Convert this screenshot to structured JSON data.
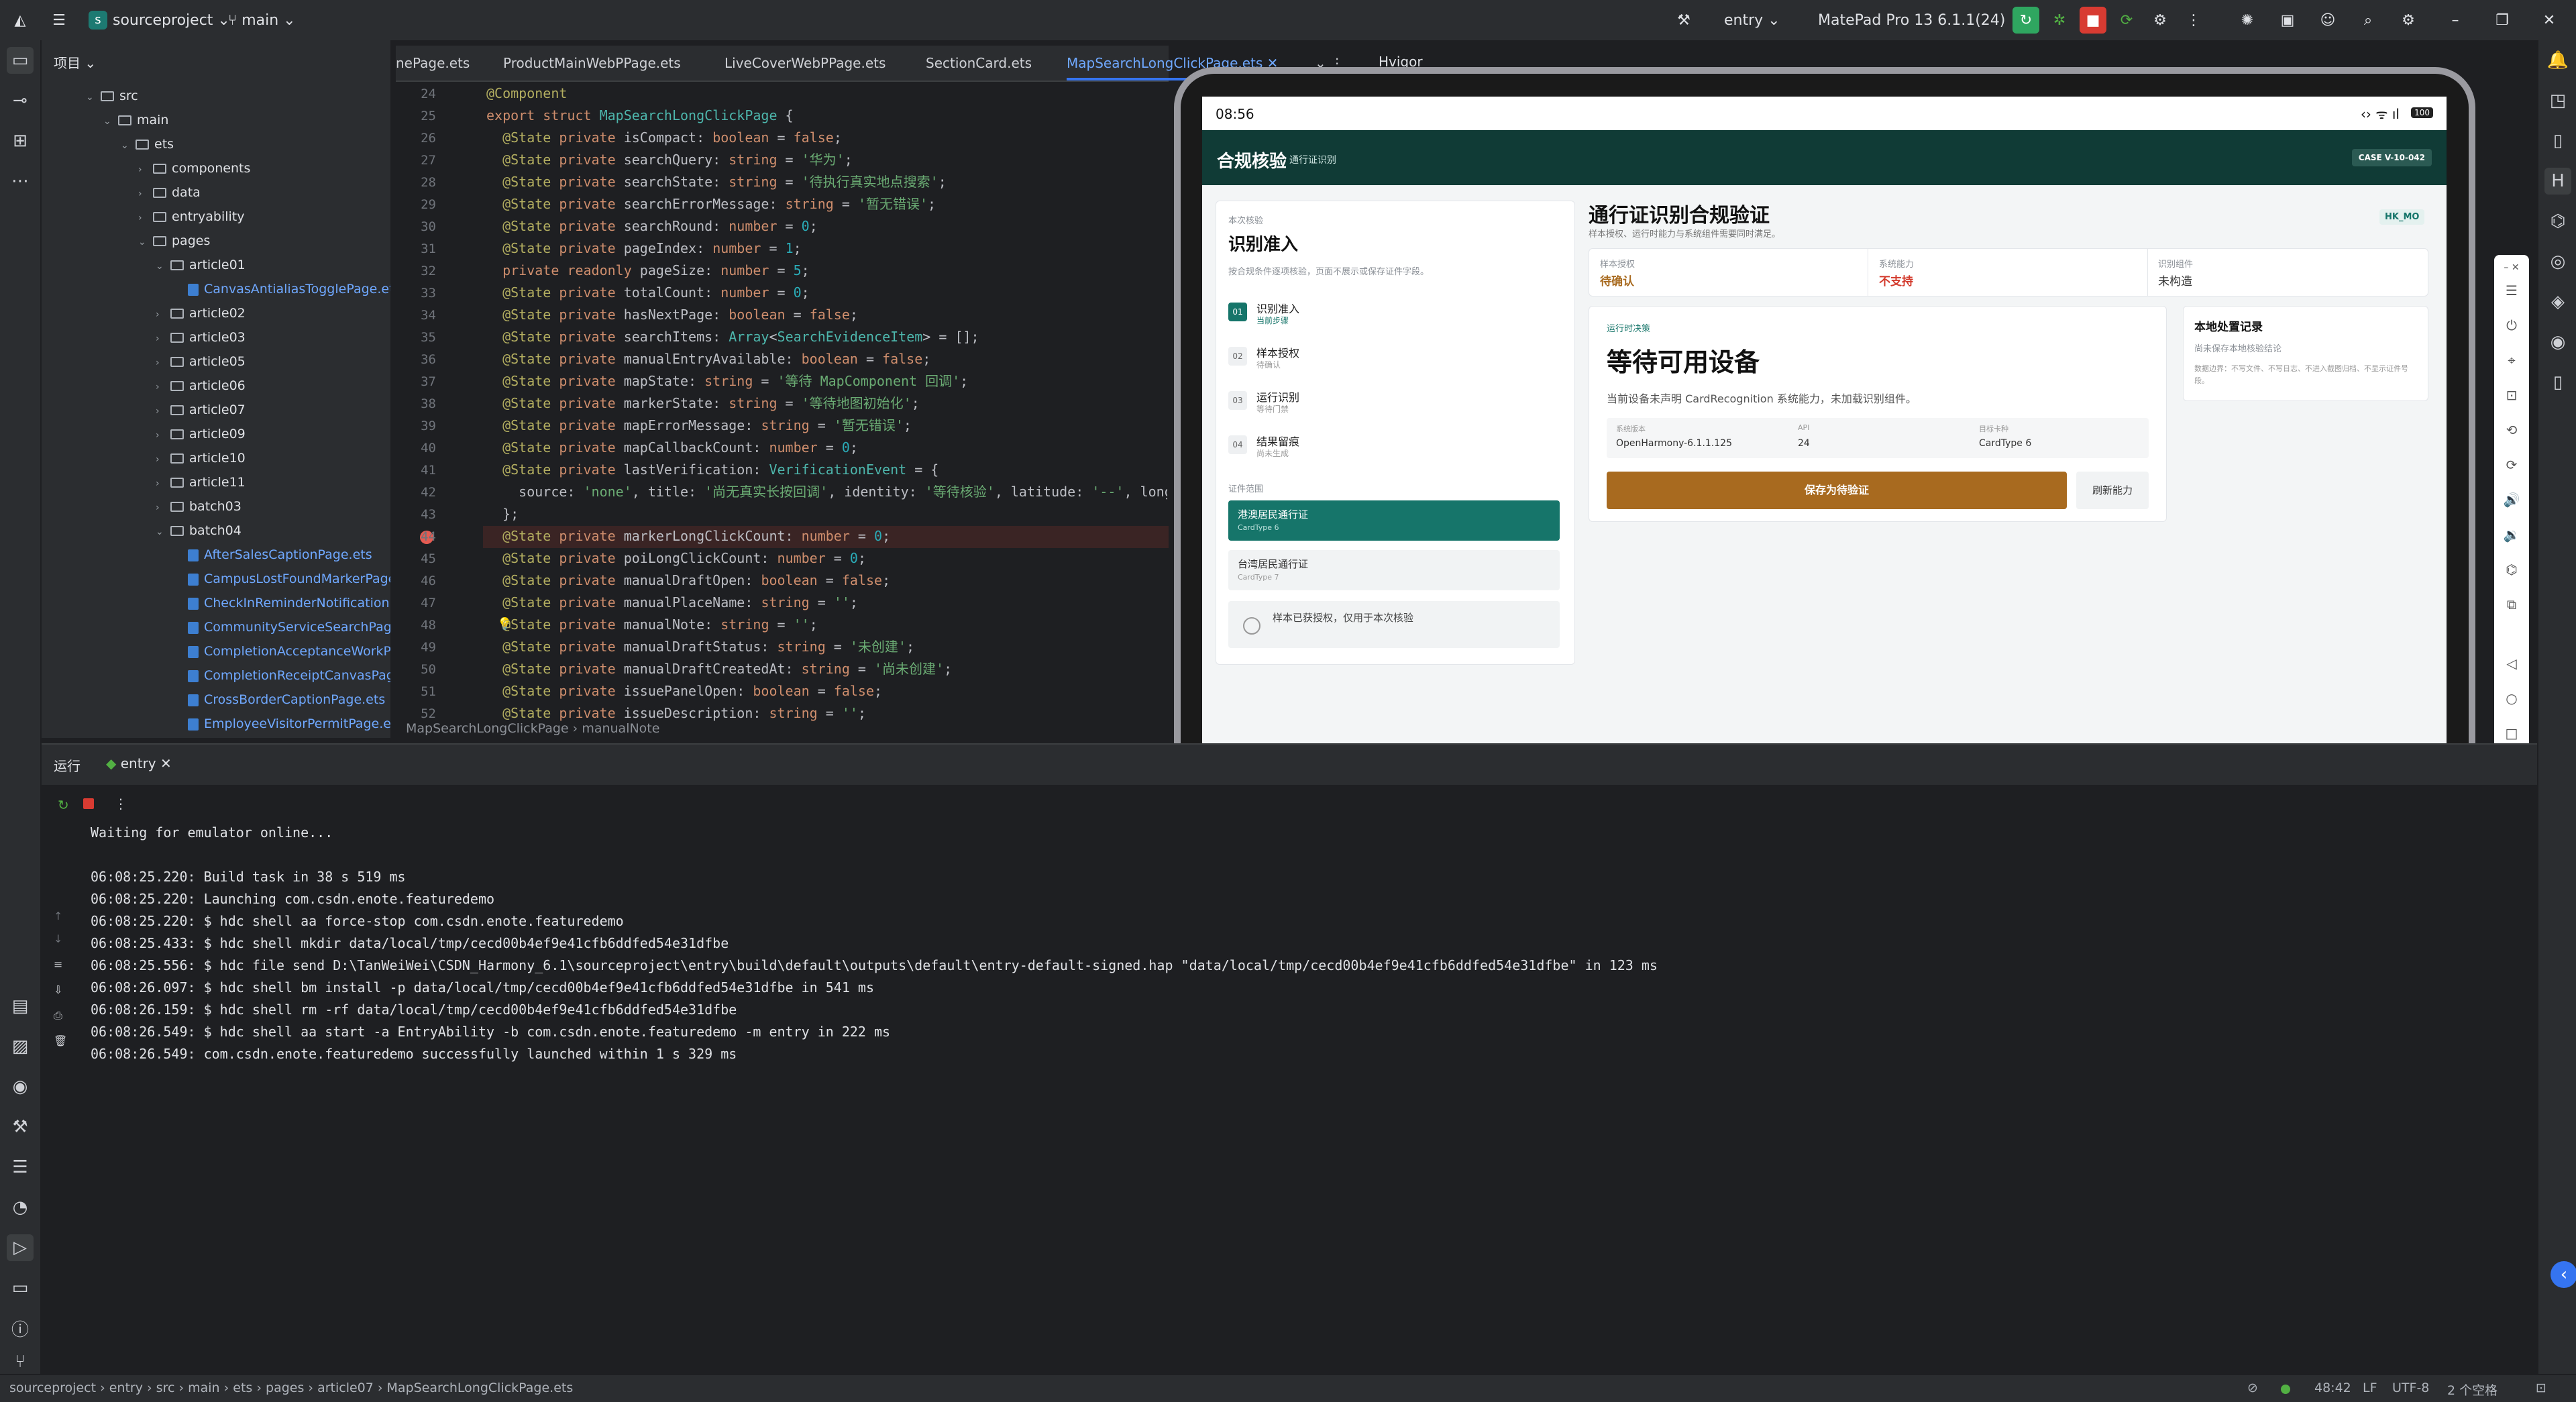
{
  "ide": {
    "project": "sourceproject",
    "branch": "main",
    "run_config": "entry",
    "device": "MatePad Pro 13 6.1.1(24)",
    "project_panel_title": "项目",
    "tree": [
      {
        "label": "src",
        "depth": 1,
        "kind": "folder"
      },
      {
        "label": "main",
        "depth": 2,
        "kind": "folder"
      },
      {
        "label": "ets",
        "depth": 3,
        "kind": "folder"
      },
      {
        "label": "components",
        "depth": 4,
        "kind": "folder"
      },
      {
        "label": "data",
        "depth": 4,
        "kind": "folder"
      },
      {
        "label": "entryability",
        "depth": 4,
        "kind": "folder"
      },
      {
        "label": "pages",
        "depth": 4,
        "kind": "folder"
      },
      {
        "label": "article01",
        "depth": 5,
        "kind": "folder"
      },
      {
        "label": "CanvasAntialiasTogglePage.ets",
        "depth": 6,
        "kind": "file"
      },
      {
        "label": "article02",
        "depth": 5,
        "kind": "folder"
      },
      {
        "label": "article03",
        "depth": 5,
        "kind": "folder"
      },
      {
        "label": "article05",
        "depth": 5,
        "kind": "folder"
      },
      {
        "label": "article06",
        "depth": 5,
        "kind": "folder"
      },
      {
        "label": "article07",
        "depth": 5,
        "kind": "folder"
      },
      {
        "label": "article09",
        "depth": 5,
        "kind": "folder"
      },
      {
        "label": "article10",
        "depth": 5,
        "kind": "folder"
      },
      {
        "label": "article11",
        "depth": 5,
        "kind": "folder"
      },
      {
        "label": "batch03",
        "depth": 5,
        "kind": "folder"
      },
      {
        "label": "batch04",
        "depth": 5,
        "kind": "folder"
      },
      {
        "label": "AfterSalesCaptionPage.ets",
        "depth": 6,
        "kind": "file"
      },
      {
        "label": "CampusLostFoundMarkerPage.ets",
        "depth": 6,
        "kind": "file"
      },
      {
        "label": "CheckInReminderNotificationPage.ets",
        "depth": 6,
        "kind": "file"
      },
      {
        "label": "CommunityServiceSearchPage.ets",
        "depth": 6,
        "kind": "file"
      },
      {
        "label": "CompletionAcceptanceWorkPage.ets",
        "depth": 6,
        "kind": "file"
      },
      {
        "label": "CompletionReceiptCanvasPage.ets",
        "depth": 6,
        "kind": "file"
      },
      {
        "label": "CrossBorderCaptionPage.ets",
        "depth": 6,
        "kind": "file"
      },
      {
        "label": "EmployeeVisitorPermitPage.ets",
        "depth": 6,
        "kind": "file"
      }
    ],
    "tabs": [
      "nePage.ets",
      "ProductMainWebPPage.ets",
      "LiveCoverWebPPage.ets",
      "SectionCard.ets",
      "MapSearchLongClickPage.ets"
    ],
    "hvigor": "Hvigor",
    "line_numbers": [
      "24",
      "25",
      "26",
      "27",
      "28",
      "29",
      "30",
      "31",
      "32",
      "33",
      "34",
      "35",
      "36",
      "37",
      "38",
      "39",
      "40",
      "41",
      "42",
      "43",
      "44",
      "45",
      "46",
      "47",
      "48",
      "49",
      "50",
      "51",
      "52"
    ],
    "code": [
      "@Component",
      "export struct MapSearchLongClickPage {",
      "  @State private isCompact: boolean = false;",
      "  @State private searchQuery: string = '华为';",
      "  @State private searchState: string = '待执行真实地点搜索';",
      "  @State private searchErrorMessage: string = '暂无错误';",
      "  @State private searchRound: number = 0;",
      "  @State private pageIndex: number = 1;",
      "  private readonly pageSize: number = 5;",
      "  @State private totalCount: number = 0;",
      "  @State private hasNextPage: boolean = false;",
      "  @State private searchItems: Array<SearchEvidenceItem> = [];",
      "  @State private manualEntryAvailable: boolean = false;",
      "  @State private mapState: string = '等待 MapComponent 回调';",
      "  @State private markerState: string = '等待地图初始化';",
      "  @State private mapErrorMessage: string = '暂无错误';",
      "  @State private mapCallbackCount: number = 0;",
      "  @State private lastVerification: VerificationEvent = {",
      "    source: 'none', title: '尚无真实长按回调', identity: '等待核验', latitude: '--', longi",
      "  };",
      "  @State private markerLongClickCount: number = 0;",
      "  @State private poiLongClickCount: number = 0;",
      "  @State private manualDraftOpen: boolean = false;",
      "  @State private manualPlaceName: string = '';",
      "  @State private manualNote: string = '';",
      "  @State private manualDraftStatus: string = '未创建';",
      "  @State private manualDraftCreatedAt: string = '尚未创建';",
      "  @State private issuePanelOpen: boolean = false;",
      "  @State private issueDescription: string = '';"
    ],
    "breadcrumb": [
      "MapSearchLongClickPage",
      "manualNote"
    ],
    "run_tab": "运行",
    "run_config_tab": "entry",
    "log": [
      "Waiting for emulator online...",
      "",
      "06:08:25.220: Build task in 38 s 519 ms",
      "06:08:25.220: Launching com.csdn.enote.featuredemo",
      "06:08:25.220: $ hdc shell aa force-stop com.csdn.enote.featuredemo",
      "06:08:25.433: $ hdc shell mkdir data/local/tmp/cecd00b4ef9e41cfb6ddfed54e31dfbe",
      "06:08:25.556: $ hdc file send D:\\TanWeiWei\\CSDN_Harmony_6.1\\sourceproject\\entry\\build\\default\\outputs\\default\\entry-default-signed.hap \"data/local/tmp/cecd00b4ef9e41cfb6ddfed54e31dfbe\" in 123 ms",
      "06:08:26.097: $ hdc shell bm install -p data/local/tmp/cecd00b4ef9e41cfb6ddfed54e31dfbe in 541 ms",
      "06:08:26.159: $ hdc shell rm -rf data/local/tmp/cecd00b4ef9e41cfb6ddfed54e31dfbe",
      "06:08:26.549: $ hdc shell aa start -a EntryAbility -b com.csdn.enote.featuredemo -m entry in 222 ms",
      "06:08:26.549: com.csdn.enote.featuredemo successfully launched within 1 s 329 ms"
    ],
    "status_path": [
      "sourceproject",
      "entry",
      "src",
      "main",
      "ets",
      "pages",
      "article07",
      "MapSearchLongClickPage.ets"
    ],
    "status_right": {
      "pos": "48:42",
      "eol": "LF",
      "enc": "UTF-8",
      "indent": "2 个空格"
    }
  },
  "app": {
    "time": "08:56",
    "battery": "100",
    "header_title": "合规核验",
    "header_sub": "通行证识别",
    "case_badge": "CASE V-10-042",
    "left_tag": "本次核验",
    "left_title": "识别准入",
    "left_desc": "按合规条件逐项核验，页面不展示或保存证件字段。",
    "steps": [
      {
        "num": "01",
        "title": "识别准入",
        "sub": "当前步骤"
      },
      {
        "num": "02",
        "title": "样本授权",
        "sub": "待确认"
      },
      {
        "num": "03",
        "title": "运行识别",
        "sub": "等待门禁"
      },
      {
        "num": "04",
        "title": "结果留痕",
        "sub": "尚未生成"
      }
    ],
    "scope_label": "证件范围",
    "scope_options": [
      {
        "title": "港澳居民通行证",
        "sub": "CardType 6"
      },
      {
        "title": "台湾居民通行证",
        "sub": "CardType 7"
      }
    ],
    "consent": "样本已获授权，仅用于本次核验",
    "main_title": "通行证识别合规验证",
    "main_sub": "样本授权、运行时能力与系统组件需要同时满足。",
    "hk_badge": "HK_MO",
    "kpis": [
      {
        "label": "样本授权",
        "value": "待确认"
      },
      {
        "label": "系统能力",
        "value": "不支持"
      },
      {
        "label": "识别组件",
        "value": "未构造"
      }
    ],
    "decision_tag": "运行时决策",
    "decision_title": "等待可用设备",
    "decision_desc": "当前设备未声明 CardRecognition 系统能力，未加载识别组件。",
    "info": [
      {
        "label": "系统版本",
        "value": "OpenHarmony-6.1.1.125"
      },
      {
        "label": "API",
        "value": "24"
      },
      {
        "label": "目标卡种",
        "value": "CardType 6"
      }
    ],
    "save_btn": "保存为待验证",
    "refresh_btn": "刷新能力",
    "record_title": "本地处置记录",
    "record_sub": "尚未保存本地核验结论",
    "record_desc": "数据边界：不写文件、不写日志、不进入截图归档、不显示证件号段。",
    "colors": {
      "primary": "#16756a",
      "header": "#103b36",
      "accent": "#a86a1f",
      "danger": "#d33a2c"
    }
  }
}
